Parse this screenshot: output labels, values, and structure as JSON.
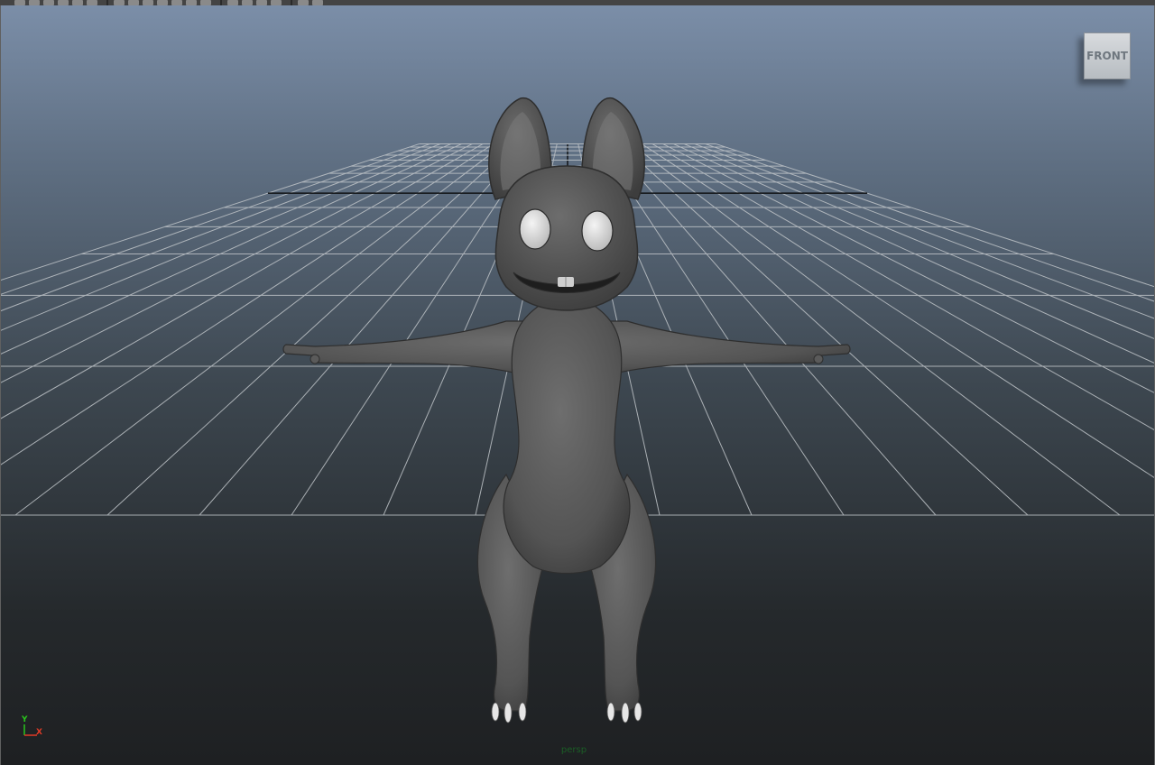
{
  "viewport": {
    "view_cube_face": "FRONT",
    "camera_name": "persp",
    "axis_labels": {
      "y": "Y",
      "x": "X"
    }
  },
  "colors": {
    "axis_x": "#e23b26",
    "axis_y": "#29c41c",
    "camera_label": "#1b5e26",
    "grid": "#bfc4c8",
    "model": "#5a5a5a"
  },
  "toolbar": {
    "icons": [
      "select-tool-icon",
      "lasso-icon",
      "paint-select-icon",
      "move-icon",
      "rotate-icon",
      "scale-icon",
      "layout-single-icon",
      "layout-four-icon",
      "layout-side-icon",
      "layout-top-icon",
      "grid-toggle-icon",
      "wireframe-icon",
      "smooth-shade-icon",
      "textured-icon",
      "lighting-icon",
      "shadow-icon",
      "xray-icon",
      "isolate-icon",
      "hud-icon"
    ]
  }
}
